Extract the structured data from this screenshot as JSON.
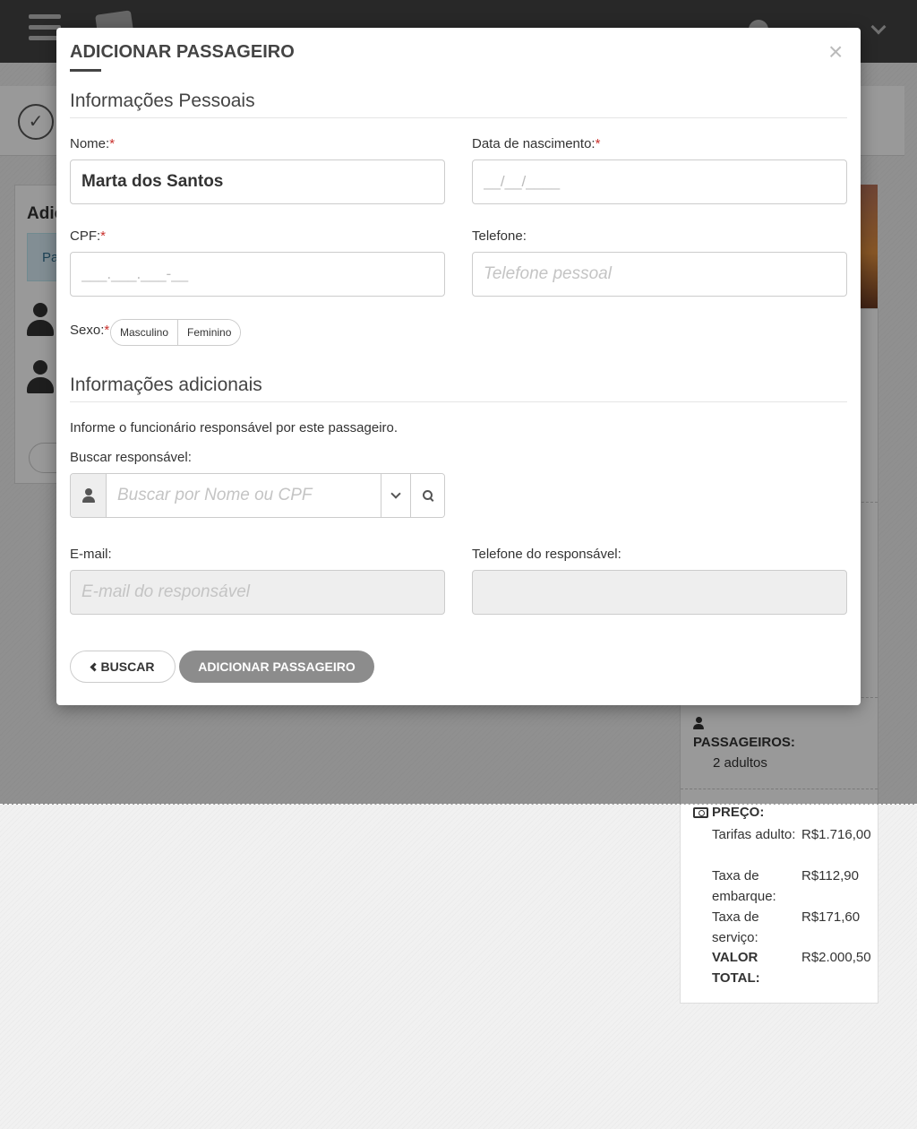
{
  "modal": {
    "title": "ADICIONAR PASSAGEIRO",
    "close": "×",
    "personal_section": "Informações Pessoais",
    "name": {
      "label": "Nome:",
      "required": "*",
      "value": "Marta dos Santos"
    },
    "birth": {
      "label": "Data de nascimento:",
      "required": "*",
      "placeholder": "__/__/____"
    },
    "cpf": {
      "label": "CPF:",
      "required": "*",
      "placeholder": "___.___.___-__"
    },
    "phone": {
      "label": "Telefone:",
      "placeholder": "Telefone pessoal"
    },
    "sex": {
      "label": "Sexo:",
      "required": "*",
      "options": [
        "Masculino",
        "Feminino"
      ]
    },
    "additional_section": "Informações adicionais",
    "help_text": "Informe o funcionário responsável por este passageiro.",
    "search": {
      "label": "Buscar responsável:",
      "placeholder": "Buscar por Nome ou CPF"
    },
    "email": {
      "label": "E-mail:",
      "placeholder": "E-mail do responsável"
    },
    "resp_phone": {
      "label": "Telefone do responsável:"
    },
    "back_button": "BUSCAR",
    "add_button": "ADICIONAR PASSAGEIRO"
  },
  "background": {
    "left_title": "Adic",
    "left_tab": "Pa",
    "check_icon": "✓",
    "summary": {
      "passengers_label": "PASSAGEIROS:",
      "passengers_value": "2 adultos",
      "price_label": "PREÇO:",
      "rows": [
        {
          "label": "Tarifas adulto:",
          "value": "R$1.716,00"
        },
        {
          "label": "Taxa de embarque:",
          "value": "R$112,90"
        },
        {
          "label": "Taxa de serviço:",
          "value": "R$171,60"
        },
        {
          "label": "VALOR TOTAL:",
          "value": "R$2.000,50"
        }
      ]
    }
  },
  "colors": {
    "topbar": "#444444",
    "required": "#c9302c",
    "primary_disabled": "#8c8c8c"
  }
}
